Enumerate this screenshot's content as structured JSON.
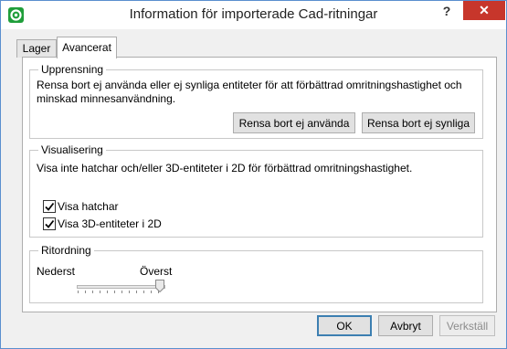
{
  "window": {
    "title": "Information för importerade Cad-ritningar",
    "help_label": "?",
    "close_label": "✕"
  },
  "tabs": [
    {
      "label": "Lager",
      "active": false
    },
    {
      "label": "Avancerat",
      "active": true
    }
  ],
  "cleanup": {
    "title": "Upprensning",
    "description": "Rensa bort ej använda eller ej synliga entiteter för att förbättrad omritningshastighet och minskad minnesanvändning.",
    "remove_unused_label": "Rensa bort ej använda",
    "remove_invisible_label": "Rensa bort ej synliga"
  },
  "visualization": {
    "title": "Visualisering",
    "description": "Visa inte hatchar och/eller 3D-entiteter i 2D för förbättrad omritningshastighet.",
    "show_hatches_label": "Visa hatchar",
    "show_hatches_checked": true,
    "show_3d_label": "Visa 3D-entiteter i 2D",
    "show_3d_checked": true
  },
  "draw_order": {
    "title": "Ritordning",
    "min_label": "Nederst",
    "max_label": "Överst",
    "value": 1.0
  },
  "footer": {
    "ok_label": "OK",
    "cancel_label": "Avbryt",
    "apply_label": "Verkställ"
  }
}
